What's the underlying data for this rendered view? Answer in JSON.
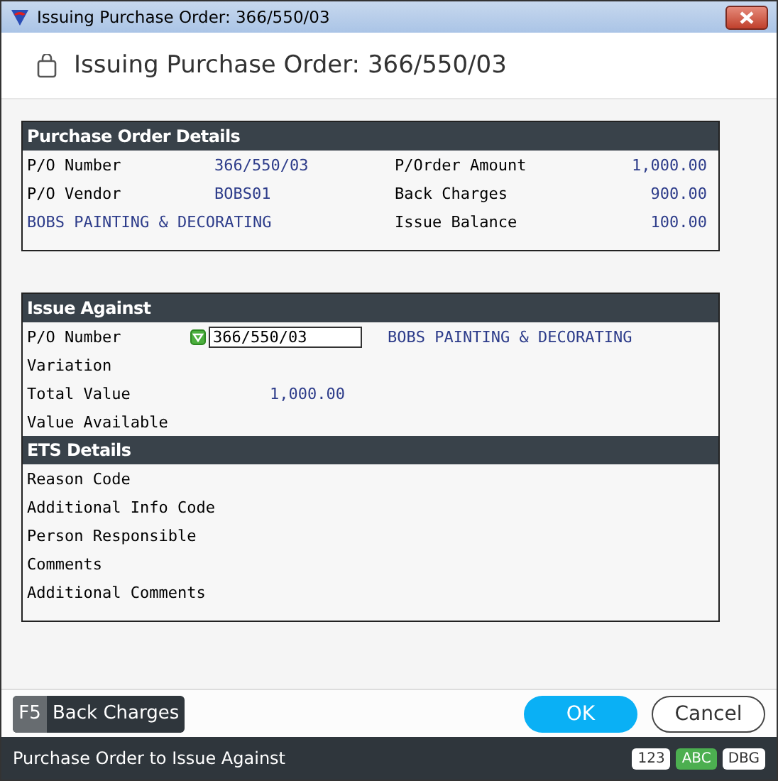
{
  "window": {
    "title": "Issuing Purchase Order: 366/550/03"
  },
  "header": {
    "title": "Issuing Purchase Order: 366/550/03"
  },
  "po_details": {
    "title": "Purchase Order Details",
    "rows": [
      {
        "label": "P/O Number",
        "value": "366/550/03",
        "label_2": "P/Order Amount",
        "value_2": "1,000.00"
      },
      {
        "label": "P/O Vendor",
        "value": "BOBS01",
        "label_2": "Back Charges",
        "value_2": "900.00"
      },
      {
        "vendor_name": "BOBS PAINTING & DECORATING",
        "label_2": "Issue Balance",
        "value_2": "100.00"
      }
    ]
  },
  "issue_against": {
    "title": "Issue Against",
    "po_number": {
      "label": "P/O Number",
      "value": "366/550/03",
      "vendor_name": "BOBS PAINTING & DECORATING"
    },
    "rows": [
      {
        "label": "Variation"
      },
      {
        "label": "Total Value",
        "value": "1,000.00"
      },
      {
        "label": "Value Available"
      }
    ]
  },
  "ets_details": {
    "title": "ETS Details",
    "rows": [
      "Reason Code",
      "Additional Info Code",
      "Person Responsible",
      "Comments",
      "Additional Comments"
    ]
  },
  "footer": {
    "function_key": {
      "key": "F5",
      "label": "Back Charges"
    },
    "ok": "OK",
    "cancel": "Cancel"
  },
  "status_bar": {
    "message": "Purchase Order to Issue Against",
    "modes": [
      {
        "label": "123",
        "selected": false
      },
      {
        "label": "ABC",
        "selected": true
      },
      {
        "label": "DBG",
        "selected": false
      }
    ]
  }
}
